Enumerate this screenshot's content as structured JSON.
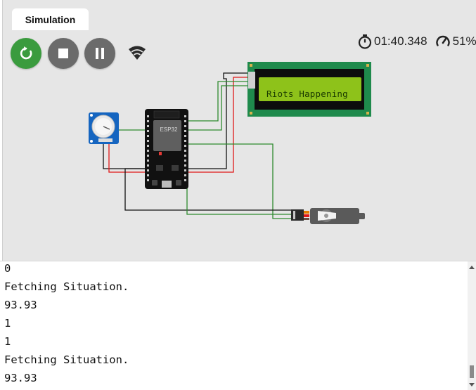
{
  "tab": {
    "label": "Simulation"
  },
  "controls": {
    "restart": "restart-icon",
    "stop": "stop-icon",
    "pause": "pause-icon",
    "wifi": "wifi-icon"
  },
  "status": {
    "elapsed": "01:40.348",
    "speed": "51%"
  },
  "circuit": {
    "lcd_text": "Riots Happening",
    "board_label": "ESP32"
  },
  "console": {
    "lines": [
      "0",
      "Fetching Situation.",
      "93.93",
      "1",
      "1",
      "Fetching Situation.",
      "93.93"
    ]
  },
  "colors": {
    "restart": "#3a9b3e",
    "controls": "#6b6b6b",
    "lcd_board": "#1f8a4c",
    "lcd_screen": "#8ec21a",
    "wire_green": "#2e8b2e",
    "wire_red": "#e01818",
    "wire_black": "#111111"
  }
}
